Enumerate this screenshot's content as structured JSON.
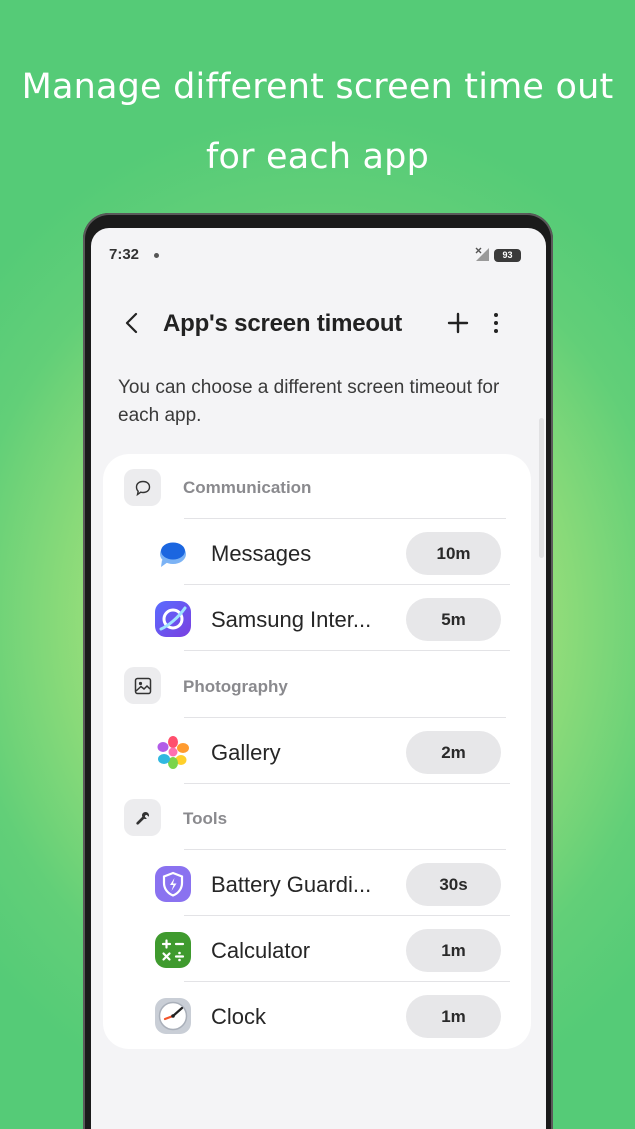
{
  "headline": {
    "line1": "Manage different screen time out",
    "line2": "for each app"
  },
  "status_bar": {
    "time": "7:32",
    "battery": "93"
  },
  "app_bar": {
    "title": "App's screen timeout"
  },
  "description": "You can choose a different screen timeout for each app.",
  "categories": [
    {
      "label": "Communication",
      "icon": "chat-bubble-icon",
      "apps": [
        {
          "name": "Messages",
          "icon": "messages-app-icon",
          "timeout": "10m"
        },
        {
          "name": "Samsung Inter...",
          "icon": "samsung-internet-app-icon",
          "timeout": "5m"
        }
      ]
    },
    {
      "label": "Photography",
      "icon": "image-icon",
      "apps": [
        {
          "name": "Gallery",
          "icon": "gallery-app-icon",
          "timeout": "2m"
        }
      ]
    },
    {
      "label": "Tools",
      "icon": "wrench-icon",
      "apps": [
        {
          "name": "Battery Guardi...",
          "icon": "battery-guardian-app-icon",
          "timeout": "30s"
        },
        {
          "name": "Calculator",
          "icon": "calculator-app-icon",
          "timeout": "1m"
        },
        {
          "name": "Clock",
          "icon": "clock-app-icon",
          "timeout": "1m"
        }
      ]
    }
  ],
  "colors": {
    "background_green": "#55cb77",
    "background_lime": "#c3ec7c",
    "card": "#ffffff",
    "pill": "#e7e7e9"
  }
}
